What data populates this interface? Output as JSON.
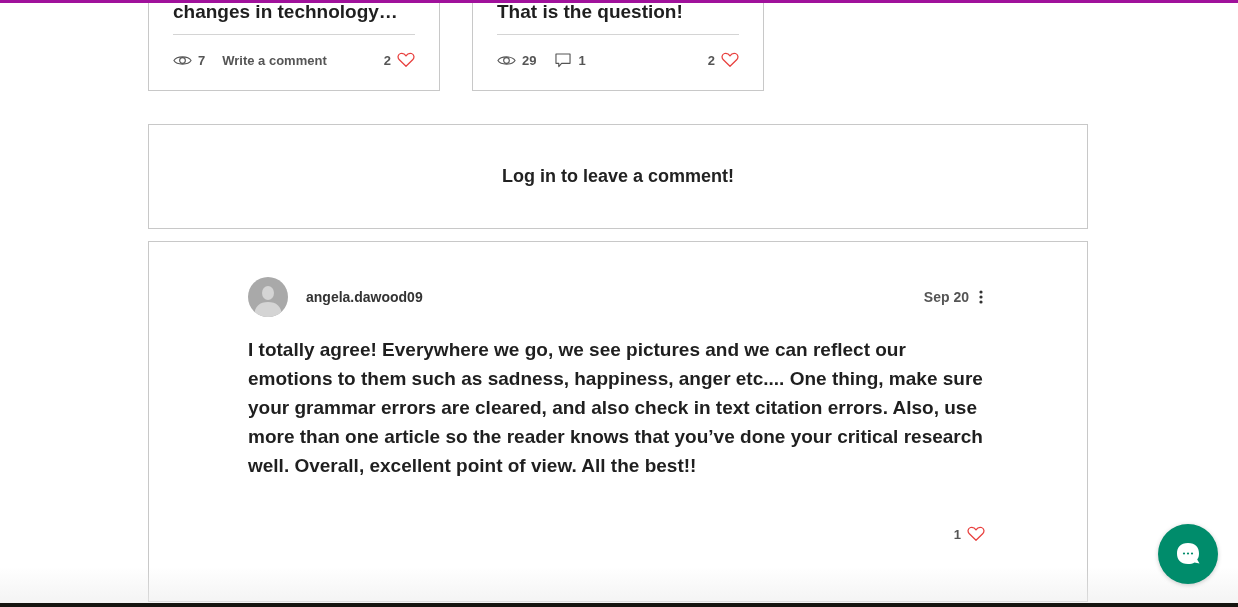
{
  "posts": [
    {
      "title": "changes in technology…",
      "views": "7",
      "comment_link": "Write a comment",
      "likes": "2"
    },
    {
      "title": "That is the question!",
      "views": "29",
      "comments": "1",
      "likes": "2"
    }
  ],
  "login_prompt": "Log in to leave a comment!",
  "comment": {
    "author": "angela.dawood09",
    "date": "Sep 20",
    "text": "I totally agree! Everywhere we go, we see pictures and we can reflect our emotions to them such as sadness, happiness, anger etc.... One thing, make sure your grammar errors are cleared, and also check in text citation errors. Also, use more than one article so the reader knows that you’ve done your critical research well. Overall, excellent point of view. All the best!!",
    "likes": "1"
  }
}
